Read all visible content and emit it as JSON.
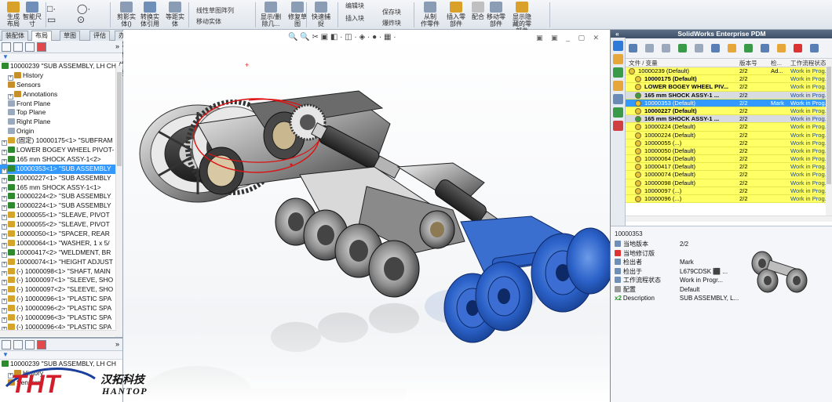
{
  "ribbon": {
    "buttons": [
      {
        "label": "生成\n布局",
        "color": "#d9a12a"
      },
      {
        "label": "智能尺\n寸",
        "color": "#6f8fb8"
      },
      {
        "label": "剪影实\n体()",
        "color": "#8a9db5"
      },
      {
        "label": "转换实\n体引用",
        "color": "#6f8fb8"
      },
      {
        "label": "等距实\n体",
        "color": "#8a9db5"
      },
      {
        "label": "显示/删\n除几...",
        "color": "#8a9db5"
      },
      {
        "label": "修复草\n图",
        "color": "#8a9db5"
      },
      {
        "label": "快速捕\n捉",
        "color": "#8a9db5"
      },
      {
        "label": "从制\n作零件",
        "color": "#8a9db5"
      },
      {
        "label": "插入零\n部件",
        "color": "#d9a12a"
      },
      {
        "label": "配合",
        "color": "#c0c0c0"
      },
      {
        "label": "移动零\n部件",
        "color": "#8a9db5"
      },
      {
        "label": "显示隐\n藏的零\n部件",
        "color": "#d9a12a"
      }
    ],
    "small_items": [
      "线性草图阵列",
      "移动实体",
      "编辑块",
      "插入块",
      "保存块",
      "爆炸块"
    ]
  },
  "left": {
    "tabs": [
      "装配体",
      "布局",
      "草图",
      "评估",
      "办公室产品"
    ],
    "active_tab": "布局",
    "tree": [
      {
        "text": "10000239 \"SUB ASSEMBLY, LH CH",
        "icon": "#2f8a2f",
        "exp": "",
        "indent": 0
      },
      {
        "text": "History",
        "icon": "#c78f2a",
        "exp": "+",
        "indent": 1
      },
      {
        "text": "Sensors",
        "icon": "#c78f2a",
        "exp": "",
        "indent": 1
      },
      {
        "text": "Annotations",
        "icon": "#c78f2a",
        "exp": "+",
        "indent": 1
      },
      {
        "text": "Front Plane",
        "icon": "#9aa9bb",
        "exp": "",
        "indent": 1
      },
      {
        "text": "Top Plane",
        "icon": "#9aa9bb",
        "exp": "",
        "indent": 1
      },
      {
        "text": "Right Plane",
        "icon": "#9aa9bb",
        "exp": "",
        "indent": 1
      },
      {
        "text": "Origin",
        "icon": "#9aa9bb",
        "exp": "",
        "indent": 1
      },
      {
        "text": "(固定) 10000175<1> \"SUBFRAM",
        "icon": "#d4a52a",
        "exp": "+",
        "indent": 0
      },
      {
        "text": "LOWER BOGEY WHEEL PIVOT-",
        "icon": "#2f8a2f",
        "exp": "+",
        "indent": 0
      },
      {
        "text": "165 mm SHOCK ASSY-1<2>",
        "icon": "#2f8a2f",
        "exp": "+",
        "indent": 0
      },
      {
        "text": "10000353<1> \"SUB ASSEMBLY",
        "icon": "#2f8a2f",
        "exp": "+",
        "indent": 0,
        "selected": true
      },
      {
        "text": "10000227<1> \"SUB ASSEMBLY",
        "icon": "#2f8a2f",
        "exp": "+",
        "indent": 0
      },
      {
        "text": "165 mm SHOCK ASSY-1<1>",
        "icon": "#2f8a2f",
        "exp": "+",
        "indent": 0
      },
      {
        "text": "10000224<2> \"SUB ASSEMBLY",
        "icon": "#2f8a2f",
        "exp": "+",
        "indent": 0
      },
      {
        "text": "10000224<1> \"SUB ASSEMBLY",
        "icon": "#2f8a2f",
        "exp": "+",
        "indent": 0
      },
      {
        "text": "10000055<1> \"SLEAVE, PIVOT",
        "icon": "#d4a52a",
        "exp": "+",
        "indent": 0
      },
      {
        "text": "10000055<2> \"SLEAVE, PIVOT",
        "icon": "#d4a52a",
        "exp": "+",
        "indent": 0
      },
      {
        "text": "10000050<1> \"SPACER, REAR",
        "icon": "#d4a52a",
        "exp": "+",
        "indent": 0
      },
      {
        "text": "10000064<1> \"WASHER, 1 x 5/",
        "icon": "#d4a52a",
        "exp": "+",
        "indent": 0
      },
      {
        "text": "10000417<2> \"WELDMENT, BR",
        "icon": "#2f8a2f",
        "exp": "+",
        "indent": 0
      },
      {
        "text": "10000074<1> \"HEIGHT ADJUST",
        "icon": "#d4a52a",
        "exp": "+",
        "indent": 0
      },
      {
        "text": "(-) 10000098<1> \"SHAFT, MAIN",
        "icon": "#d4a52a",
        "exp": "+",
        "indent": 0
      },
      {
        "text": "(-) 10000097<1> \"SLEEVE, SHO",
        "icon": "#d4a52a",
        "exp": "+",
        "indent": 0
      },
      {
        "text": "(-) 10000097<2> \"SLEEVE, SHO",
        "icon": "#d4a52a",
        "exp": "+",
        "indent": 0
      },
      {
        "text": "(-) 10000096<1> \"PLASTIC SPA",
        "icon": "#d4a52a",
        "exp": "+",
        "indent": 0
      },
      {
        "text": "(-) 10000096<2> \"PLASTIC SPA",
        "icon": "#d4a52a",
        "exp": "+",
        "indent": 0
      },
      {
        "text": "(-) 10000096<3> \"PLASTIC SPA",
        "icon": "#d4a52a",
        "exp": "+",
        "indent": 0
      },
      {
        "text": "(-) 10000096<4> \"PLASTIC SPA",
        "icon": "#d4a52a",
        "exp": "+",
        "indent": 0
      }
    ],
    "tree2": [
      {
        "text": "10000239 \"SUB ASSEMBLY, LH CH",
        "icon": "#2f8a2f",
        "exp": "",
        "indent": 0
      },
      {
        "text": "History",
        "icon": "#c78f2a",
        "exp": "+",
        "indent": 1
      },
      {
        "text": "Sensors",
        "icon": "#c78f2a",
        "exp": "",
        "indent": 1
      }
    ],
    "filter_symbol": "▼"
  },
  "graphics": {
    "hud_icons": "🔍 🔍 ✂ ▣ ◧ · ◫ · ◈ · ● · ▦ ·",
    "window_controls": "▣ ▣ _ ▢ ✕"
  },
  "pdm": {
    "title": "SolidWorks Enterprise PDM",
    "collapse_symbol": "«",
    "columns": [
      "文件 / 变量",
      "版本号",
      "检...",
      "工作流程状态"
    ],
    "rows": [
      {
        "name": "10000239  (Default)",
        "ver": "2/2",
        "chk": "Ad...",
        "state": "Work in Prog...",
        "style": "",
        "bold": false
      },
      {
        "name": "10000175  (Default)",
        "ver": "2/2",
        "chk": "",
        "state": "Work in Prog...",
        "style": "",
        "bold": true
      },
      {
        "name": "LOWER BOGEY WHEEL PIV...",
        "ver": "2/2",
        "chk": "",
        "state": "Work in Prog...",
        "style": "",
        "bold": true
      },
      {
        "name": "165 mm SHOCK ASSY-1 ...",
        "ver": "2/2",
        "chk": "",
        "state": "Work in Prog...",
        "style": "grey",
        "bold": true
      },
      {
        "name": "10000353  (Default)",
        "ver": "2/2",
        "chk": "Mark",
        "state": "Work in Prog...",
        "style": "sel",
        "bold": false
      },
      {
        "name": "10000227  (Default)",
        "ver": "2/2",
        "chk": "",
        "state": "Work in Prog...",
        "style": "",
        "bold": true
      },
      {
        "name": "165 mm SHOCK ASSY-1 ...",
        "ver": "2/2",
        "chk": "",
        "state": "Work in Prog...",
        "style": "grey",
        "bold": true
      },
      {
        "name": "10000224  (Default)",
        "ver": "2/2",
        "chk": "",
        "state": "Work in Prog...",
        "style": "",
        "bold": false
      },
      {
        "name": "10000224  (Default)",
        "ver": "2/2",
        "chk": "",
        "state": "Work in Prog...",
        "style": "",
        "bold": false
      },
      {
        "name": "10000055  (...)",
        "ver": "2/2",
        "chk": "",
        "state": "Work in Prog...",
        "style": "",
        "bold": false
      },
      {
        "name": "10000050  (Default)",
        "ver": "2/2",
        "chk": "",
        "state": "Work in Prog...",
        "style": "",
        "bold": false
      },
      {
        "name": "10000064  (Default)",
        "ver": "2/2",
        "chk": "",
        "state": "Work in Prog...",
        "style": "",
        "bold": false
      },
      {
        "name": "10000417  (Default)",
        "ver": "2/2",
        "chk": "",
        "state": "Work in Prog...",
        "style": "",
        "bold": false
      },
      {
        "name": "10000074  (Default)",
        "ver": "2/2",
        "chk": "",
        "state": "Work in Prog...",
        "style": "",
        "bold": false
      },
      {
        "name": "10000098  (Default)",
        "ver": "2/2",
        "chk": "",
        "state": "Work in Prog...",
        "style": "",
        "bold": false
      },
      {
        "name": "10000097  (...)",
        "ver": "2/2",
        "chk": "",
        "state": "Work in Prog...",
        "style": "",
        "bold": false
      },
      {
        "name": "10000096  (...)",
        "ver": "2/2",
        "chk": "",
        "state": "Work in Prog...",
        "style": "",
        "bold": false
      }
    ],
    "detail_id": "10000353",
    "detail": [
      {
        "key": "当地版本",
        "val": "2/2",
        "icon": "#6f8fb8"
      },
      {
        "key": "当地修订版",
        "val": "",
        "icon": "#d33"
      },
      {
        "key": "检出者",
        "val": "Mark",
        "icon": "#6f8fb8"
      },
      {
        "key": "检出于",
        "val": "L679CDSK ⬛ ...",
        "icon": "#6f8fb8"
      },
      {
        "key": "工作流程状态",
        "val": "Work in Progr...",
        "icon": "#6f8fb8"
      },
      {
        "key": "配置",
        "val": "Default",
        "icon": "#999"
      },
      {
        "key": "Description",
        "val": "SUB ASSEMBLY, L...",
        "icon": "#2f8a2f",
        "prefix": "x2"
      }
    ]
  },
  "logo": {
    "brand": "THT",
    "cn": "汉拓科技",
    "en": "HANTOP"
  }
}
